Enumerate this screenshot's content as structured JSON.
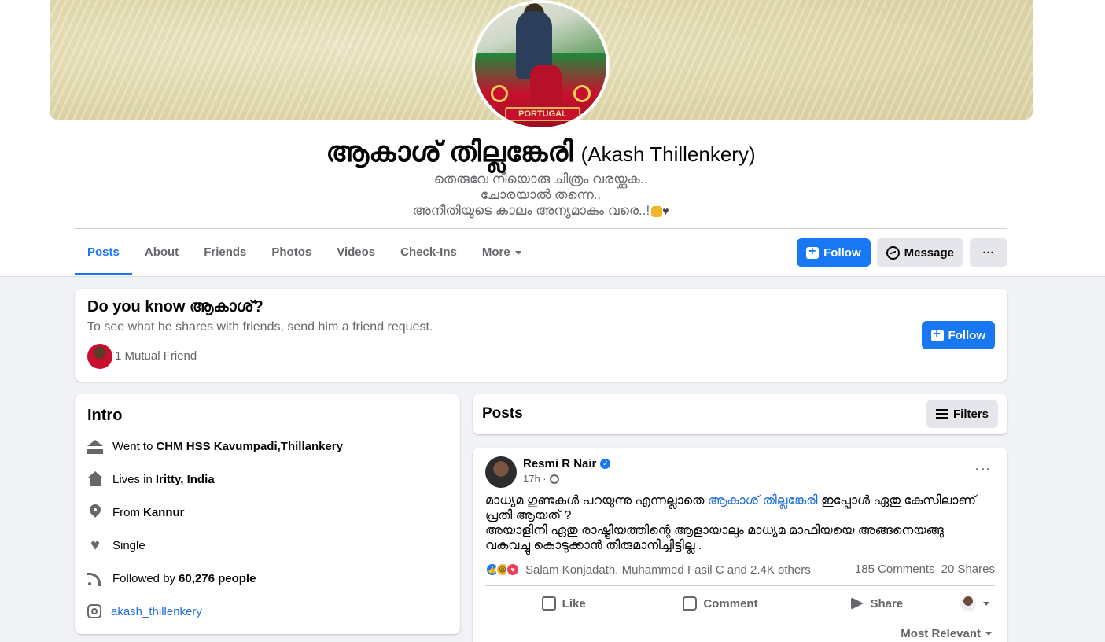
{
  "profile": {
    "name": "ആകാശ് തില്ലങ്കേരി",
    "alt_name": "(Akash Thillenkery)",
    "bio_lines": [
      "തെരുവേ നീയൊരു ചിത്രം വരയ്ക്കുക..",
      "ചോരയാൽ തന്നെ..",
      "അനീതിയുടെ കാലം അന്യമാകും വരെ..!"
    ],
    "avatar_banner": "PORTUGAL"
  },
  "tabs": [
    {
      "label": "Posts",
      "active": true
    },
    {
      "label": "About"
    },
    {
      "label": "Friends"
    },
    {
      "label": "Photos"
    },
    {
      "label": "Videos"
    },
    {
      "label": "Check-Ins"
    },
    {
      "label": "More"
    }
  ],
  "actions": {
    "follow_label": "Follow",
    "message_label": "Message",
    "more_label": "···"
  },
  "know": {
    "title": "Do you know ആകാശ്?",
    "subtitle": "To see what he shares with friends, send him a friend request.",
    "mutual": "1 Mutual Friend",
    "follow_label": "Follow"
  },
  "intro": {
    "title": "Intro",
    "items": [
      {
        "icon": "graduation-cap-icon",
        "prefix": "Went to",
        "value": "CHM HSS Kavumpadi,Thillankery"
      },
      {
        "icon": "home-icon",
        "prefix": "Lives in",
        "value": "Iritty, India"
      },
      {
        "icon": "location-pin-icon",
        "prefix": "From",
        "value": "Kannur"
      },
      {
        "icon": "heart-icon",
        "prefix": "Single",
        "value": ""
      },
      {
        "icon": "rss-icon",
        "prefix": "Followed by",
        "value": "60,276 people"
      },
      {
        "icon": "instagram-icon",
        "prefix": "",
        "value": "akash_thillenkery"
      }
    ]
  },
  "posts_header": {
    "title": "Posts",
    "filters_label": "Filters"
  },
  "post": {
    "author": "Resmi R Nair",
    "time": "17h ·",
    "text_before": "മാധ്യമ ഗുണ്ടകൾ പറയുന്നു എന്നല്ലാതെ ",
    "mention": "ആകാശ് തില്ലങ്കേരി",
    "text_after": " ഇപ്പോൾ ഏതു കേസിലാണ് പ്രതി ആയത് ?",
    "text_line2": "അയാളിനി ഏതു രാഷ്ട്രീയത്തിന്റെ ആളായാലും മാധ്യമ മാഫിയയെ അങ്ങനെയങ്ങു വകവച്ചു കൊടുക്കാൻ തീരുമാനിച്ചിട്ടില്ല .",
    "reactors": "Salam Konjadath, Muhammed Fasil C and 2.4K others",
    "comments": "185 Comments",
    "shares": "20 Shares",
    "like_label": "Like",
    "comment_label": "Comment",
    "share_label": "Share",
    "sort_label": "Most Relevant"
  },
  "colors": {
    "accent": "#1877f2",
    "background": "#f0f2f5",
    "secondary_text": "#65676b"
  }
}
